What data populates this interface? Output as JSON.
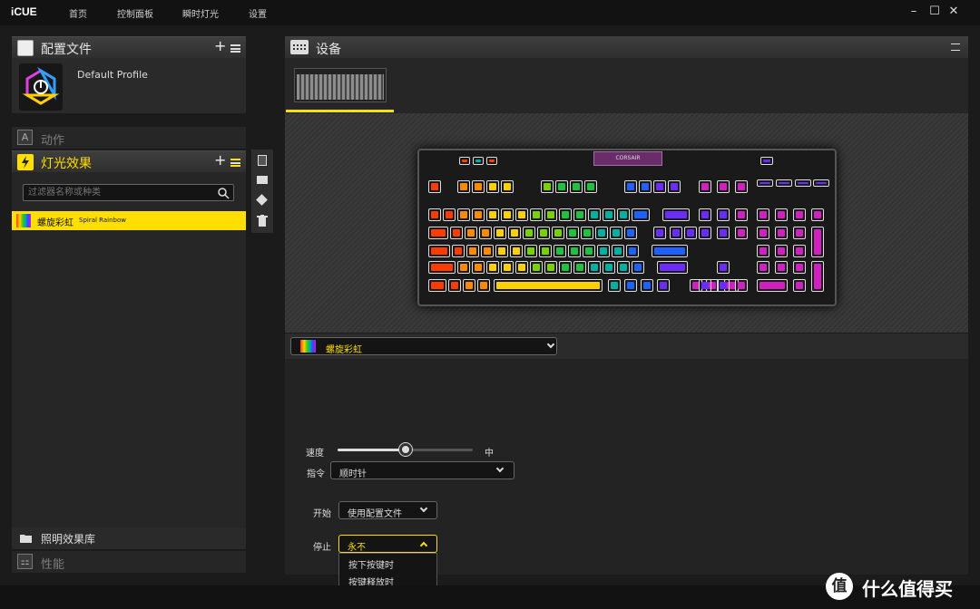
{
  "app": {
    "title": "iCUE"
  },
  "nav": [
    "首页",
    "控制面板",
    "瞬时灯光",
    "设置"
  ],
  "window_controls": {
    "minimize": "–",
    "maximize": "☐",
    "close": "✕"
  },
  "profiles": {
    "title": "配置文件",
    "add": "+",
    "items": [
      {
        "name": "Default Profile"
      }
    ]
  },
  "actions": {
    "title": "动作",
    "icon": "A"
  },
  "lighting": {
    "title": "灯光效果",
    "add": "+",
    "filter_placeholder": "过滤器名称或种类",
    "items": [
      {
        "name": "螺旋彩虹",
        "subtitle": "Spiral Rainbow"
      }
    ]
  },
  "library": {
    "title": "照明效果库"
  },
  "performance": {
    "title": "性能"
  },
  "device": {
    "title": "设备",
    "brand_label": "CORSAIR"
  },
  "effect": {
    "selected": "螺旋彩虹",
    "speed_label": "速度",
    "speed_value_label": "中",
    "speed": 0.5,
    "direction_label": "指令",
    "direction_value": "顺时针",
    "start_label": "开始",
    "start_value": "使用配置文件",
    "stop_label": "停止",
    "stop_value": "永不",
    "stop_options": [
      "按下按键时",
      "按键释放时",
      "永不"
    ]
  },
  "watermark": {
    "text": "值 什么值得买"
  },
  "colors": {
    "accent": "#ffdf00",
    "rainbow": [
      "#ff3b00",
      "#ff8a00",
      "#ffd000",
      "#7bd000",
      "#20c040",
      "#00b0a0",
      "#2060ff",
      "#6a2cff",
      "#d020c0"
    ]
  }
}
